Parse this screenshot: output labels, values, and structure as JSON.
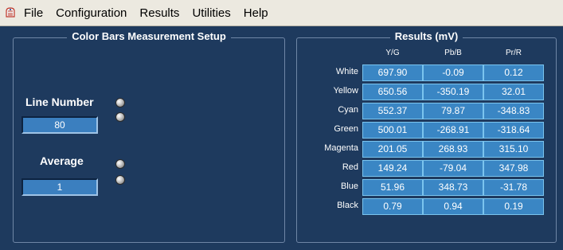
{
  "menu": {
    "items": [
      "File",
      "Configuration",
      "Results",
      "Utilities",
      "Help"
    ]
  },
  "setup_panel": {
    "title": "Color Bars Measurement Setup",
    "line_number_label": "Line Number",
    "line_number_value": "80",
    "average_label": "Average",
    "average_value": "1"
  },
  "results_panel": {
    "title": "Results (mV)",
    "columns": [
      "Y/G",
      "Pb/B",
      "Pr/R"
    ],
    "rows": [
      {
        "label": "White",
        "values": [
          "697.90",
          "-0.09",
          "0.12"
        ]
      },
      {
        "label": "Yellow",
        "values": [
          "650.56",
          "-350.19",
          "32.01"
        ]
      },
      {
        "label": "Cyan",
        "values": [
          "552.37",
          "79.87",
          "-348.83"
        ]
      },
      {
        "label": "Green",
        "values": [
          "500.01",
          "-268.91",
          "-318.64"
        ]
      },
      {
        "label": "Magenta",
        "values": [
          "201.05",
          "268.93",
          "315.10"
        ]
      },
      {
        "label": "Red",
        "values": [
          "149.24",
          "-79.04",
          "347.98"
        ]
      },
      {
        "label": "Blue",
        "values": [
          "51.96",
          "348.73",
          "-31.78"
        ]
      },
      {
        "label": "Black",
        "values": [
          "0.79",
          "0.94",
          "0.19"
        ]
      }
    ]
  },
  "colors": {
    "background": "#1e3a5e",
    "cell": "#3a86c4",
    "menubar": "#ece9e0"
  }
}
